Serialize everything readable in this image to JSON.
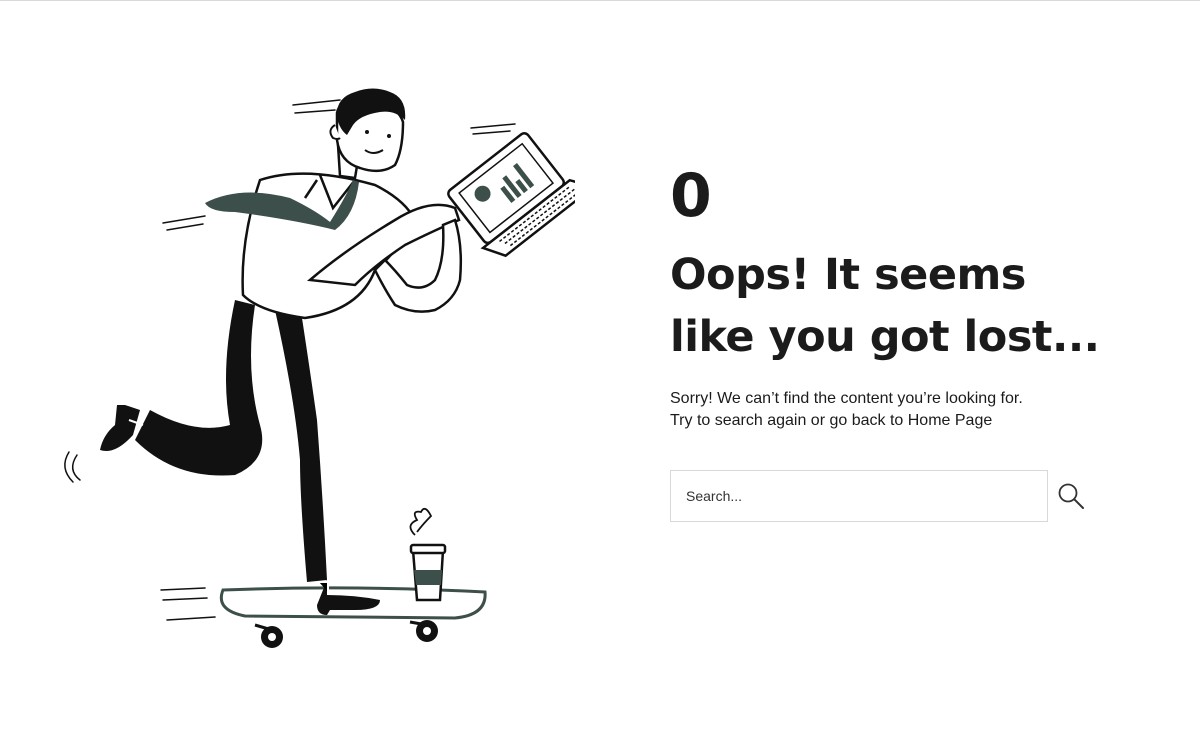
{
  "page": {
    "error_code": "0",
    "headline_line1": "Oops! It seems",
    "headline_line2": "like you got lost...",
    "message_line1": "Sorry! We can’t find the content you’re looking for.",
    "message_line2": "Try to search again or go back to Home Page"
  },
  "search": {
    "placeholder": "Search...",
    "value": "",
    "button_icon": "search-icon"
  },
  "illustration": {
    "subject": "man-on-skateboard-with-laptop",
    "accent_color": "#3d4f4a",
    "ink_color": "#111111"
  }
}
